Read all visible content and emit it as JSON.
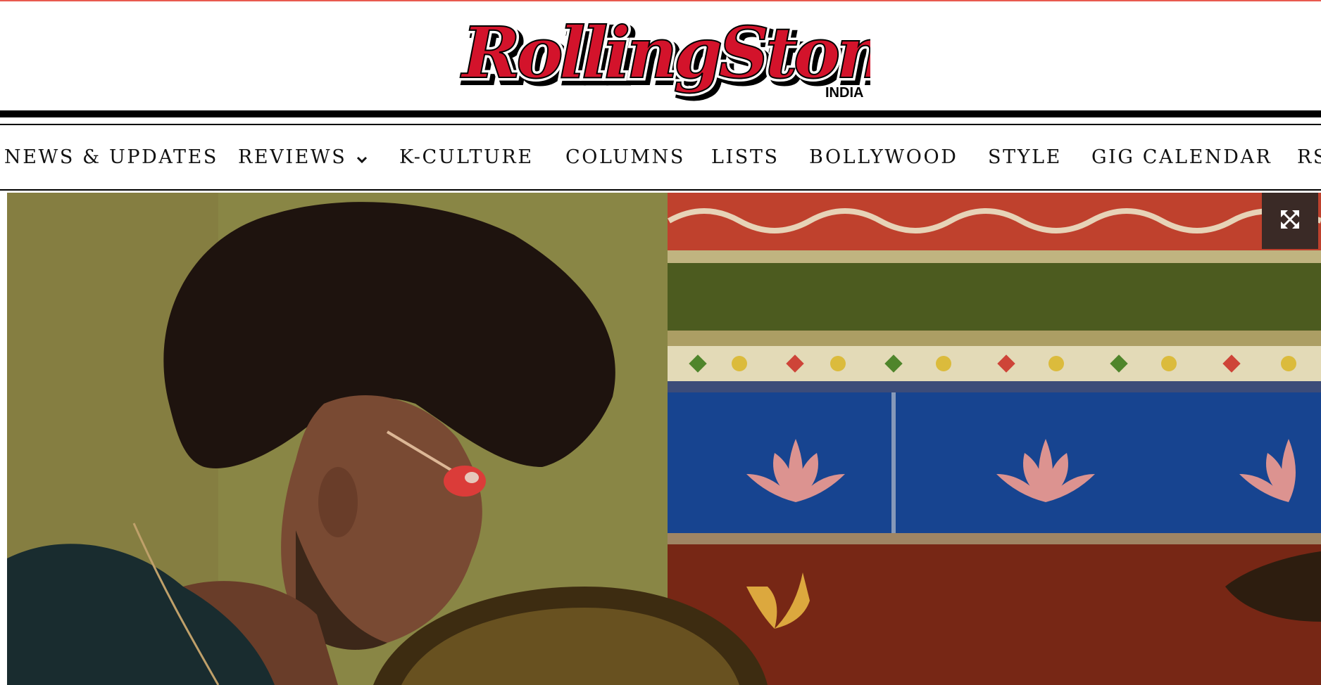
{
  "header": {
    "logo_text": "RollingStone",
    "logo_edition": "INDIA"
  },
  "nav": {
    "items": [
      {
        "label": "NEWS & UPDATES"
      },
      {
        "label": "REVIEWS",
        "icon": "chevron-down-icon"
      },
      {
        "label": "K-CULTURE"
      },
      {
        "label": "COLUMNS"
      },
      {
        "label": "LISTS"
      },
      {
        "label": "BOLLYWOOD"
      },
      {
        "label": "STYLE"
      },
      {
        "label": "GIG CALENDAR"
      },
      {
        "label": "RS"
      }
    ]
  },
  "hero": {
    "expand_icon": "expand-icon"
  },
  "colors": {
    "brand_red": "#d3132b",
    "accent_top": "#e85a4f",
    "text": "#111111"
  }
}
